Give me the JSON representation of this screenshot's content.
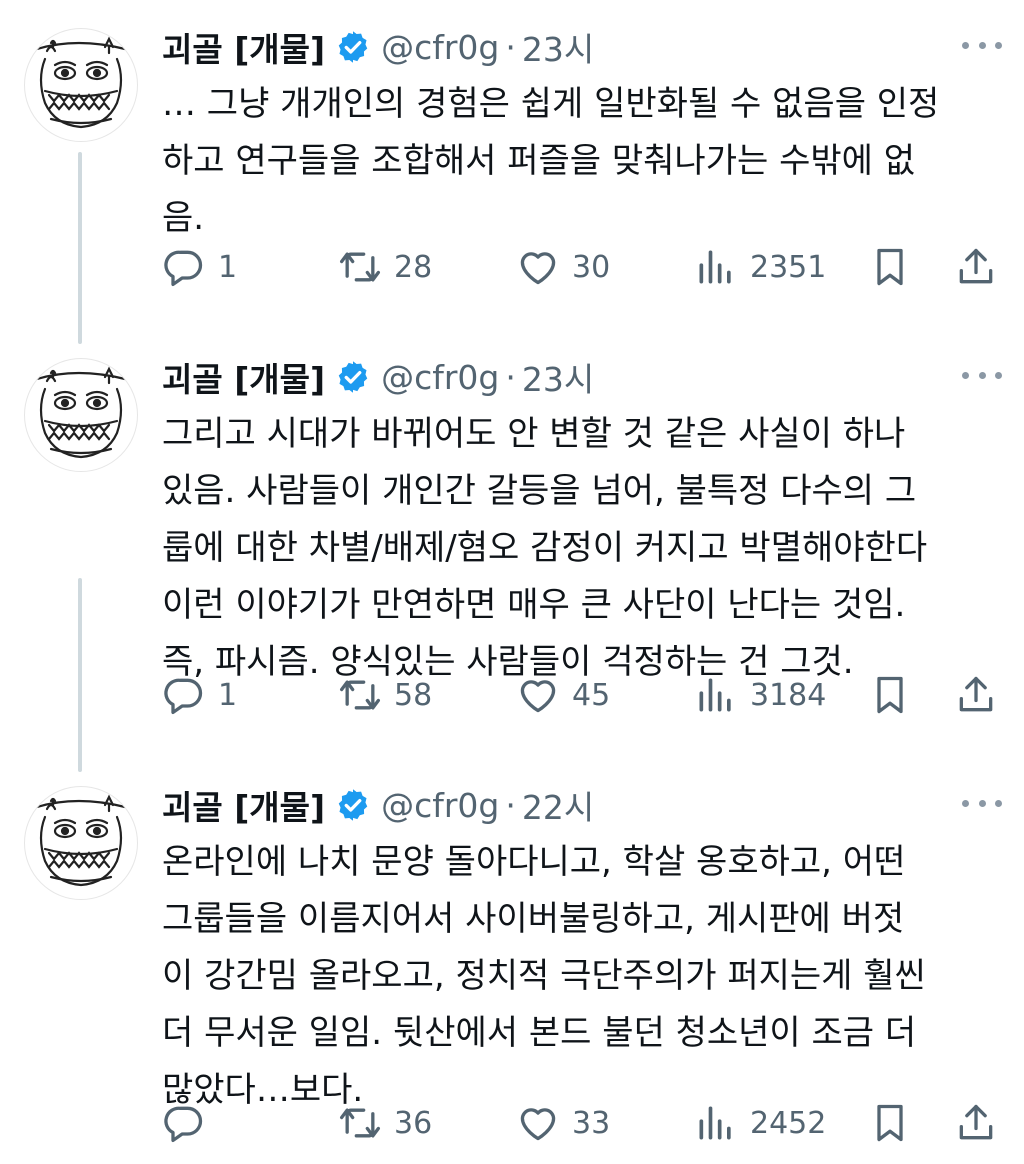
{
  "colors": {
    "text": "#0f1419",
    "secondary": "#536471",
    "verified": "#1d9bf0",
    "thread_line": "#cfd9de"
  },
  "tweets": [
    {
      "name": "괴골 [개물]",
      "handle": "@cfr0g",
      "separator": "·",
      "time": "23시",
      "lines": [
        "… 그냥 개개인의 경험은 쉽게 일반화될 수 없음을 인정",
        "하고 연구들을 조합해서 퍼즐을 맞춰나가는 수밖에 없",
        "음."
      ],
      "replies": "1",
      "retweets": "28",
      "likes": "30",
      "views": "2351"
    },
    {
      "name": "괴골 [개물]",
      "handle": "@cfr0g",
      "separator": "·",
      "time": "23시",
      "lines": [
        "그리고 시대가 바뀌어도 안 변할 것 같은 사실이 하나",
        "있음. 사람들이 개인간 갈등을 넘어, 불특정 다수의 그",
        "룹에 대한 차별/배제/혐오 감정이 커지고 박멸해야한다",
        "이런 이야기가 만연하면 매우 큰 사단이 난다는 것임.",
        "즉, 파시즘. 양식있는 사람들이 걱정하는 건 그것."
      ],
      "replies": "1",
      "retweets": "58",
      "likes": "45",
      "views": "3184"
    },
    {
      "name": "괴골 [개물]",
      "handle": "@cfr0g",
      "separator": "·",
      "time": "22시",
      "lines": [
        "온라인에 나치 문양 돌아다니고, 학살 옹호하고, 어떤",
        "그룹들을 이름지어서 사이버불링하고, 게시판에 버젓",
        "이 강간밈 올라오고, 정치적 극단주의가 퍼지는게 훨씬",
        "더 무서운 일임. 뒷산에서 본드 불던 청소년이 조금 더",
        "많았다…보다."
      ],
      "replies": "",
      "retweets": "36",
      "likes": "33",
      "views": "2452"
    }
  ],
  "icons": {
    "avatar": "frog-doodle-avatar",
    "verified": "verified-badge-icon",
    "more": "more-dots-icon",
    "reply": "reply-icon",
    "retweet": "retweet-icon",
    "like": "heart-icon",
    "views": "views-icon",
    "bookmark": "bookmark-icon",
    "share": "share-icon"
  }
}
